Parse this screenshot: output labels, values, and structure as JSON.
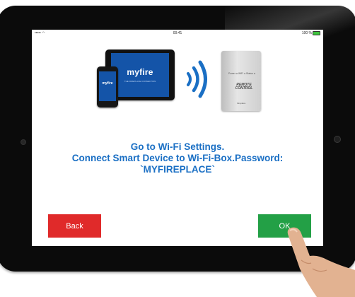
{
  "statusbar": {
    "signal": "••••• ◠",
    "time": "00:41",
    "battery_text": "100 %"
  },
  "illustration": {
    "tablet_logo": "myfire",
    "tablet_tagline": "THE FIREPLACE CONNECTION",
    "phone_logo": "myfire",
    "box_label": "Power ●  WiFi ●  Status ●",
    "box_brand": "REMOTE CONTROL",
    "box_footer": "Fireplace"
  },
  "instruction": {
    "line1": "Go to Wi-Fi Settings.",
    "line2": "Connect Smart Device to Wi-Fi-Box.Password:",
    "line3": "`MYFIREPLACE`"
  },
  "buttons": {
    "back": "Back",
    "ok": "OK"
  },
  "colors": {
    "accent_blue": "#1a6fc4",
    "back_red": "#e02a2a",
    "ok_green": "#23a046"
  }
}
